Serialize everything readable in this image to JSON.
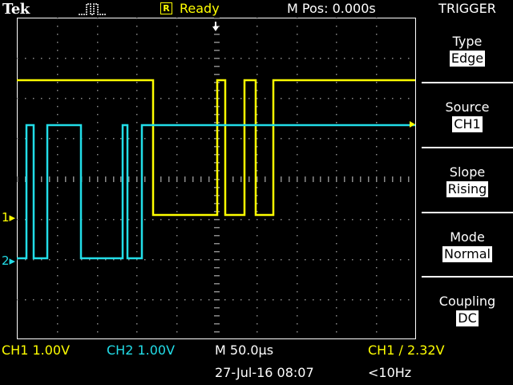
{
  "header": {
    "brand": "Tek",
    "acquisition_icon": "pulse-acquire-icon",
    "run_state_badge": "R",
    "run_state": "Ready",
    "horizontal_position": "M Pos: 0.000s"
  },
  "trigger_menu": {
    "title": "TRIGGER",
    "items": [
      {
        "label": "Type",
        "value": "Edge"
      },
      {
        "label": "Source",
        "value": "CH1"
      },
      {
        "label": "Slope",
        "value": "Rising"
      },
      {
        "label": "Mode",
        "value": "Normal"
      },
      {
        "label": "Coupling",
        "value": "DC"
      }
    ]
  },
  "channels": {
    "ch1": {
      "marker": "1",
      "color": "#ffff00"
    },
    "ch2": {
      "marker": "2",
      "color": "#22dde8"
    }
  },
  "status_bar": {
    "ch1_scale": "CH1  1.00V",
    "ch2_scale": "CH2  1.00V",
    "timebase": "M 50.0µs",
    "trigger_readout": "CH1 ∕ 2.32V",
    "datetime": "27-Jul-16 08:07",
    "trigger_frequency": "<10Hz"
  }
}
